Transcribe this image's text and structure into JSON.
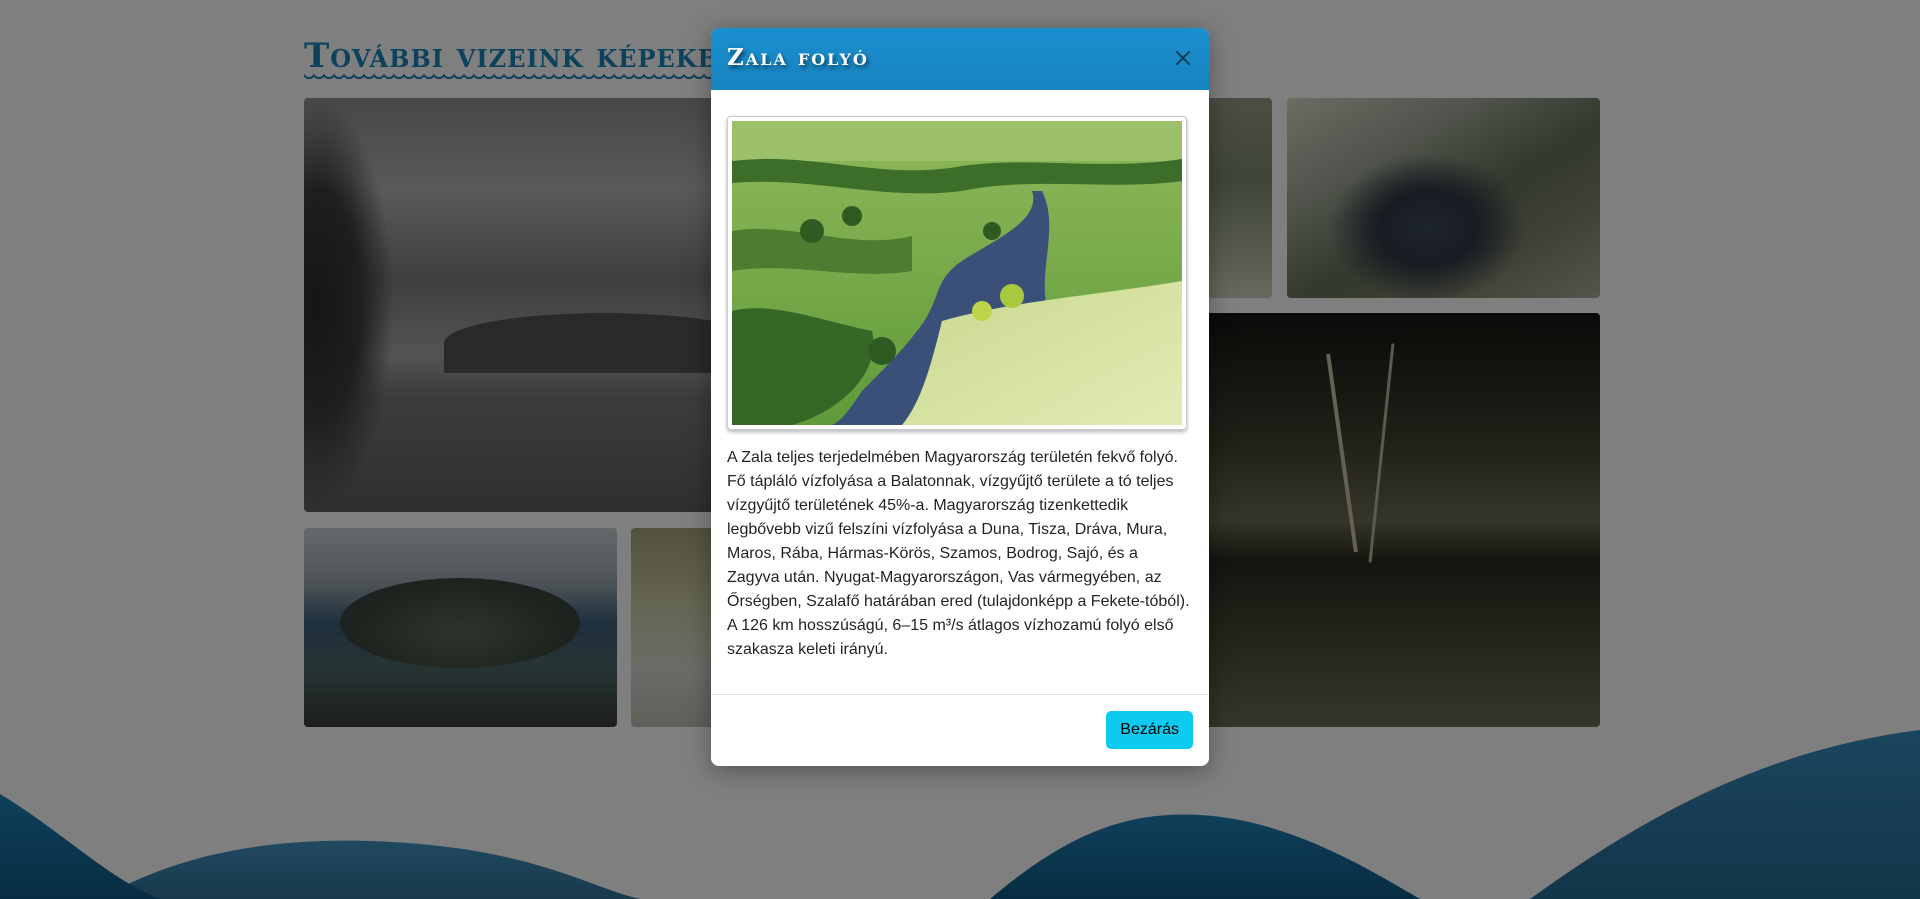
{
  "page": {
    "section_title": "További vizeink képekben"
  },
  "modal": {
    "title": "Zala folyó",
    "close_icon": "close-icon",
    "image_alt": "Zala river aerial view",
    "description": "A Zala teljes terjedelmében Magyarország területén fekvő folyó. Fő tápláló vízfolyása a Balatonnak, vízgyűjtő területe a tó teljes vízgyűjtő területének 45%-a. Magyarország tizenkettedik legbővebb vizű felszíni vízfolyása a Duna, Tisza, Dráva, Mura, Maros, Rába, Hármas-Körös, Szamos, Bodrog, Sajó, és a Zagyva után. Nyugat-Magyarországon, Vas vármegyében, az Őrségben, Szalafő határában ered (tulajdonképp a Fekete-tóból). A 126 km hosszúságú, 6–15 m³/s átlagos vízhozamú folyó első szakasza keleti irányú.",
    "close_button_label": "Bezárás"
  },
  "colors": {
    "header_bg": "#1784c0",
    "button_bg": "#0dcaf0",
    "title_accent": "#1a84b8",
    "wave": "#1b6f9e"
  }
}
